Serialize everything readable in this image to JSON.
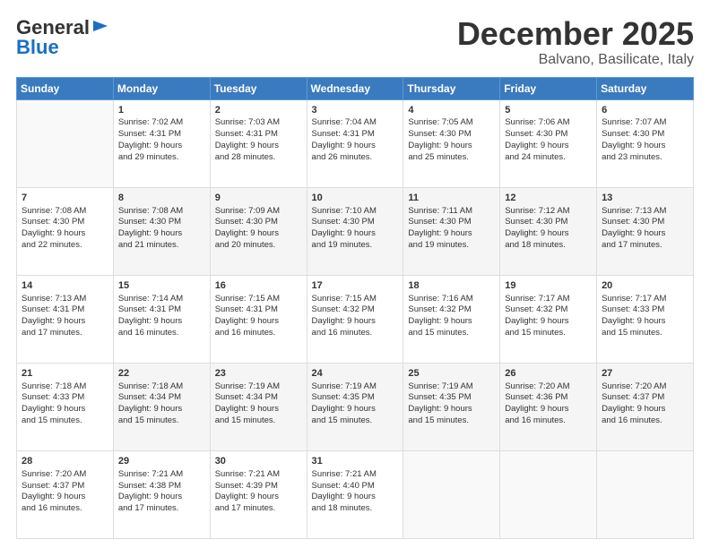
{
  "header": {
    "logo_general": "General",
    "logo_blue": "Blue",
    "month": "December 2025",
    "location": "Balvano, Basilicate, Italy"
  },
  "days_of_week": [
    "Sunday",
    "Monday",
    "Tuesday",
    "Wednesday",
    "Thursday",
    "Friday",
    "Saturday"
  ],
  "weeks": [
    [
      {
        "day": "",
        "info": ""
      },
      {
        "day": "1",
        "info": "Sunrise: 7:02 AM\nSunset: 4:31 PM\nDaylight: 9 hours\nand 29 minutes."
      },
      {
        "day": "2",
        "info": "Sunrise: 7:03 AM\nSunset: 4:31 PM\nDaylight: 9 hours\nand 28 minutes."
      },
      {
        "day": "3",
        "info": "Sunrise: 7:04 AM\nSunset: 4:31 PM\nDaylight: 9 hours\nand 26 minutes."
      },
      {
        "day": "4",
        "info": "Sunrise: 7:05 AM\nSunset: 4:30 PM\nDaylight: 9 hours\nand 25 minutes."
      },
      {
        "day": "5",
        "info": "Sunrise: 7:06 AM\nSunset: 4:30 PM\nDaylight: 9 hours\nand 24 minutes."
      },
      {
        "day": "6",
        "info": "Sunrise: 7:07 AM\nSunset: 4:30 PM\nDaylight: 9 hours\nand 23 minutes."
      }
    ],
    [
      {
        "day": "7",
        "info": "Sunrise: 7:08 AM\nSunset: 4:30 PM\nDaylight: 9 hours\nand 22 minutes."
      },
      {
        "day": "8",
        "info": "Sunrise: 7:08 AM\nSunset: 4:30 PM\nDaylight: 9 hours\nand 21 minutes."
      },
      {
        "day": "9",
        "info": "Sunrise: 7:09 AM\nSunset: 4:30 PM\nDaylight: 9 hours\nand 20 minutes."
      },
      {
        "day": "10",
        "info": "Sunrise: 7:10 AM\nSunset: 4:30 PM\nDaylight: 9 hours\nand 19 minutes."
      },
      {
        "day": "11",
        "info": "Sunrise: 7:11 AM\nSunset: 4:30 PM\nDaylight: 9 hours\nand 19 minutes."
      },
      {
        "day": "12",
        "info": "Sunrise: 7:12 AM\nSunset: 4:30 PM\nDaylight: 9 hours\nand 18 minutes."
      },
      {
        "day": "13",
        "info": "Sunrise: 7:13 AM\nSunset: 4:30 PM\nDaylight: 9 hours\nand 17 minutes."
      }
    ],
    [
      {
        "day": "14",
        "info": "Sunrise: 7:13 AM\nSunset: 4:31 PM\nDaylight: 9 hours\nand 17 minutes."
      },
      {
        "day": "15",
        "info": "Sunrise: 7:14 AM\nSunset: 4:31 PM\nDaylight: 9 hours\nand 16 minutes."
      },
      {
        "day": "16",
        "info": "Sunrise: 7:15 AM\nSunset: 4:31 PM\nDaylight: 9 hours\nand 16 minutes."
      },
      {
        "day": "17",
        "info": "Sunrise: 7:15 AM\nSunset: 4:32 PM\nDaylight: 9 hours\nand 16 minutes."
      },
      {
        "day": "18",
        "info": "Sunrise: 7:16 AM\nSunset: 4:32 PM\nDaylight: 9 hours\nand 15 minutes."
      },
      {
        "day": "19",
        "info": "Sunrise: 7:17 AM\nSunset: 4:32 PM\nDaylight: 9 hours\nand 15 minutes."
      },
      {
        "day": "20",
        "info": "Sunrise: 7:17 AM\nSunset: 4:33 PM\nDaylight: 9 hours\nand 15 minutes."
      }
    ],
    [
      {
        "day": "21",
        "info": "Sunrise: 7:18 AM\nSunset: 4:33 PM\nDaylight: 9 hours\nand 15 minutes."
      },
      {
        "day": "22",
        "info": "Sunrise: 7:18 AM\nSunset: 4:34 PM\nDaylight: 9 hours\nand 15 minutes."
      },
      {
        "day": "23",
        "info": "Sunrise: 7:19 AM\nSunset: 4:34 PM\nDaylight: 9 hours\nand 15 minutes."
      },
      {
        "day": "24",
        "info": "Sunrise: 7:19 AM\nSunset: 4:35 PM\nDaylight: 9 hours\nand 15 minutes."
      },
      {
        "day": "25",
        "info": "Sunrise: 7:19 AM\nSunset: 4:35 PM\nDaylight: 9 hours\nand 15 minutes."
      },
      {
        "day": "26",
        "info": "Sunrise: 7:20 AM\nSunset: 4:36 PM\nDaylight: 9 hours\nand 16 minutes."
      },
      {
        "day": "27",
        "info": "Sunrise: 7:20 AM\nSunset: 4:37 PM\nDaylight: 9 hours\nand 16 minutes."
      }
    ],
    [
      {
        "day": "28",
        "info": "Sunrise: 7:20 AM\nSunset: 4:37 PM\nDaylight: 9 hours\nand 16 minutes."
      },
      {
        "day": "29",
        "info": "Sunrise: 7:21 AM\nSunset: 4:38 PM\nDaylight: 9 hours\nand 17 minutes."
      },
      {
        "day": "30",
        "info": "Sunrise: 7:21 AM\nSunset: 4:39 PM\nDaylight: 9 hours\nand 17 minutes."
      },
      {
        "day": "31",
        "info": "Sunrise: 7:21 AM\nSunset: 4:40 PM\nDaylight: 9 hours\nand 18 minutes."
      },
      {
        "day": "",
        "info": ""
      },
      {
        "day": "",
        "info": ""
      },
      {
        "day": "",
        "info": ""
      }
    ]
  ]
}
